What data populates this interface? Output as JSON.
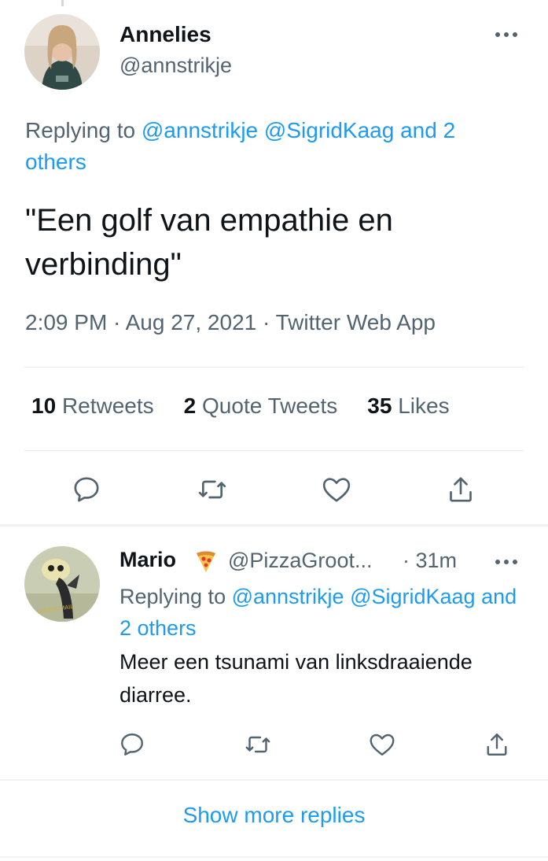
{
  "main_tweet": {
    "author_name": "Annelies",
    "author_handle": "@annstrikje",
    "replying_prefix": "Replying to ",
    "replying_mentions": [
      "@annstrikje",
      "@SigridKaag",
      "and 2 others"
    ],
    "text": "\"Een golf van empathie en verbinding\"",
    "time": "2:09 PM",
    "date": "Aug 27, 2021",
    "source": "Twitter Web App",
    "separator": " · ",
    "stats": [
      {
        "count": "10",
        "label": "Retweets"
      },
      {
        "count": "2",
        "label": "Quote Tweets"
      },
      {
        "count": "35",
        "label": "Likes"
      }
    ],
    "actions": [
      "reply-icon",
      "retweet-icon",
      "like-icon",
      "share-icon"
    ]
  },
  "reply_tweet": {
    "author_name": "Mario",
    "emoji": "pizza-icon",
    "author_handle": "@PizzaGroot...",
    "time": "· 31m",
    "replying_prefix": "Replying to ",
    "replying_mentions": [
      "@annstrikje",
      "@SigridKaag",
      "and 2 others"
    ],
    "text": "Meer een tsunami van linksdraaiende diarree.",
    "avatar_caption": "#LOOTHOMAIL"
  },
  "show_more_label": "Show more replies",
  "colors": {
    "link": "#1d9bf0",
    "secondary_text": "#536471",
    "primary_text": "#0f1419",
    "divider": "#e4e8eb"
  }
}
